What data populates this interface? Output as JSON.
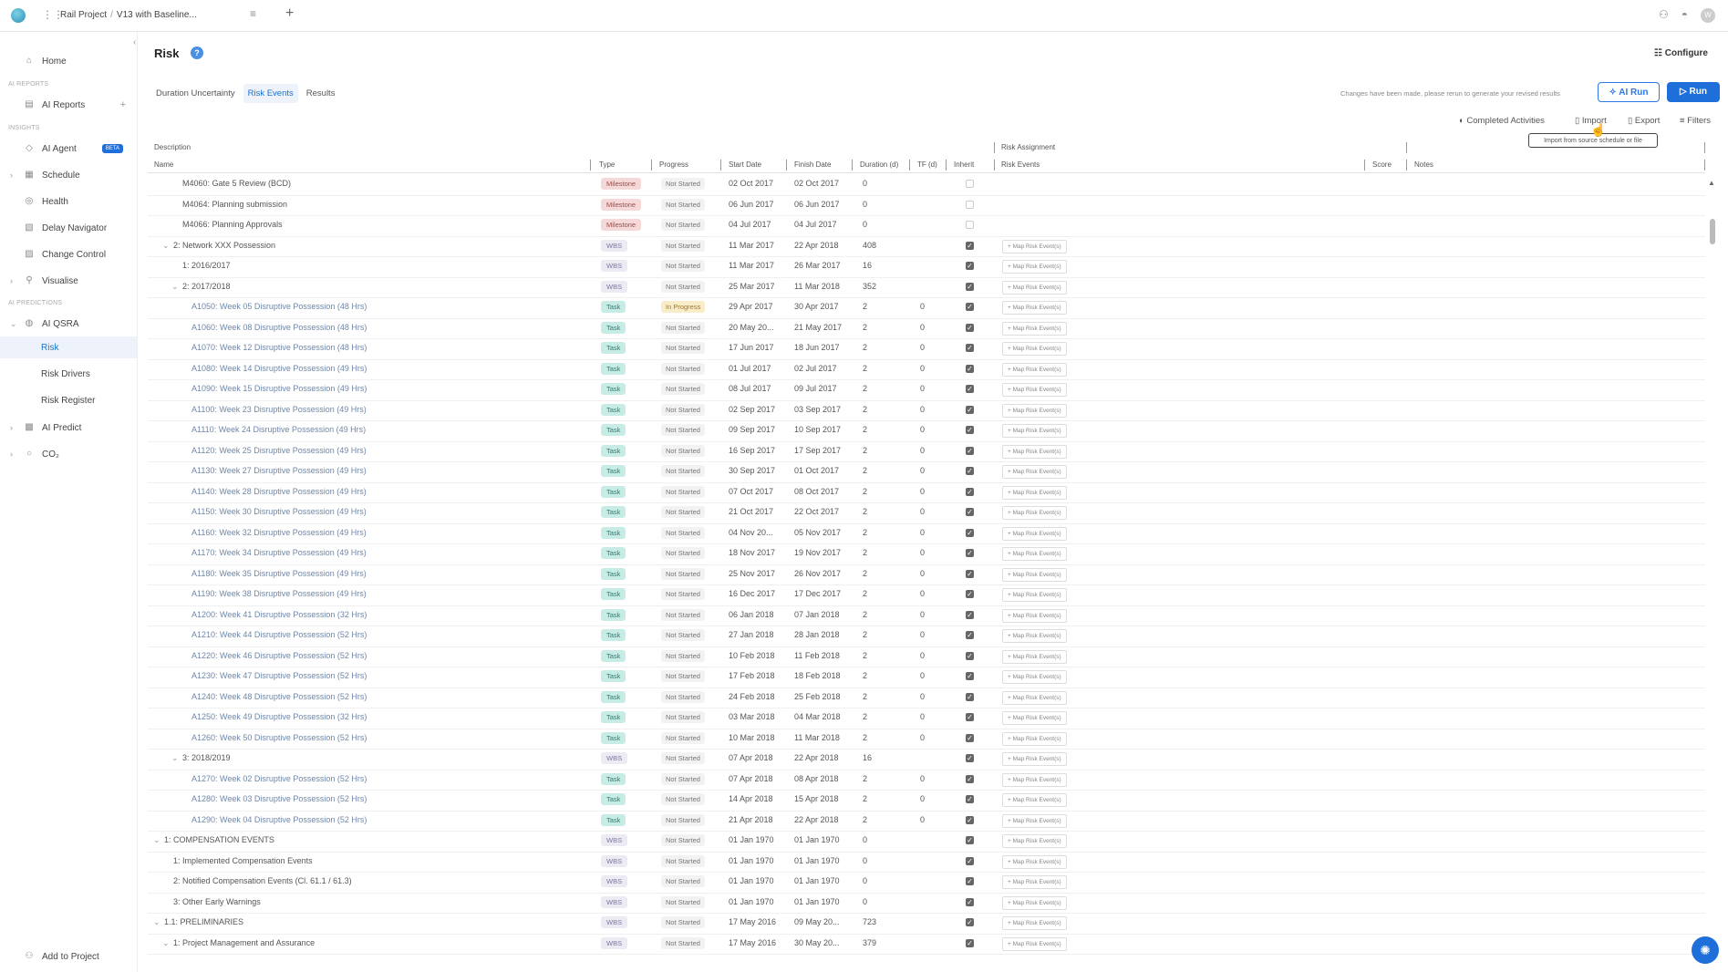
{
  "topbar": {
    "project": "Rail Project",
    "version": "V13 with Baseline...",
    "avatar": "W"
  },
  "sidebar": {
    "home": "Home",
    "section_ai_reports": "AI REPORTS",
    "ai_reports": "AI Reports",
    "section_insights": "INSIGHTS",
    "ai_agent": "AI Agent",
    "beta": "BETA",
    "schedule": "Schedule",
    "health": "Health",
    "delay_navigator": "Delay Navigator",
    "change_control": "Change Control",
    "visualise": "Visualise",
    "section_ai_predictions": "AI PREDICTIONS",
    "ai_qsra": "AI QSRA",
    "risk": "Risk",
    "risk_drivers": "Risk Drivers",
    "risk_register": "Risk Register",
    "ai_predict": "AI Predict",
    "co2": "CO₂",
    "add_to_project": "Add to Project"
  },
  "header": {
    "title": "Risk",
    "configure": "Configure",
    "tabs": [
      "Duration Uncertainty",
      "Risk Events",
      "Results"
    ],
    "active_tab": "Risk Events",
    "notice": "Changes have been made, please rerun to generate your revised results",
    "ai_run": "AI Run",
    "run": "Run"
  },
  "toolbar": {
    "completed": "Completed Activities",
    "import": "Import",
    "export": "Export",
    "filters": "Filters",
    "tooltip": "Import from source schedule or file"
  },
  "table": {
    "group_description": "Description",
    "group_risk": "Risk Assignment",
    "headers": [
      "Name",
      "Type",
      "Progress",
      "Start Date",
      "Finish Date",
      "Duration (d)",
      "TF (d)",
      "Inherit",
      "Risk Events",
      "Score",
      "Notes"
    ],
    "map_label": "+ Map Risk Event(s)",
    "rows": [
      {
        "indent": 3,
        "chev": "",
        "name": "M4060: Gate 5 Review (BCD)",
        "type": "Milestone",
        "progress": "Not Started",
        "start": "02 Oct 2017",
        "finish": "02 Oct 2017",
        "dur": "0",
        "tf": "",
        "inherit": false,
        "map": false
      },
      {
        "indent": 3,
        "chev": "",
        "name": "M4064: Planning submission",
        "type": "Milestone",
        "progress": "Not Started",
        "start": "06 Jun 2017",
        "finish": "06 Jun 2017",
        "dur": "0",
        "tf": "",
        "inherit": false,
        "map": false
      },
      {
        "indent": 3,
        "chev": "",
        "name": "M4066: Planning Approvals",
        "type": "Milestone",
        "progress": "Not Started",
        "start": "04 Jul 2017",
        "finish": "04 Jul 2017",
        "dur": "0",
        "tf": "",
        "inherit": false,
        "map": false
      },
      {
        "indent": 2,
        "chev": "v",
        "name": "2: Network XXX Possession",
        "type": "WBS",
        "progress": "Not Started",
        "start": "11 Mar 2017",
        "finish": "22 Apr 2018",
        "dur": "408",
        "tf": "",
        "inherit": true,
        "map": true
      },
      {
        "indent": 3,
        "chev": "",
        "name": "1: 2016/2017",
        "type": "WBS",
        "progress": "Not Started",
        "start": "11 Mar 2017",
        "finish": "26 Mar 2017",
        "dur": "16",
        "tf": "",
        "inherit": true,
        "map": true
      },
      {
        "indent": 3,
        "chev": "v",
        "name": "2: 2017/2018",
        "type": "WBS",
        "progress": "Not Started",
        "start": "25 Mar 2017",
        "finish": "11 Mar 2018",
        "dur": "352",
        "tf": "",
        "inherit": true,
        "map": true
      },
      {
        "indent": 4,
        "chev": "",
        "name": "A1050: Week 05 Disruptive Possession (48 Hrs)",
        "type": "Task",
        "progress": "In Progress",
        "start": "29 Apr 2017",
        "finish": "30 Apr 2017",
        "dur": "2",
        "tf": "0",
        "inherit": true,
        "map": true
      },
      {
        "indent": 4,
        "chev": "",
        "name": "A1060: Week 08 Disruptive Possession (48 Hrs)",
        "type": "Task",
        "progress": "Not Started",
        "start": "20 May 20...",
        "finish": "21 May 2017",
        "dur": "2",
        "tf": "0",
        "inherit": true,
        "map": true
      },
      {
        "indent": 4,
        "chev": "",
        "name": "A1070: Week 12 Disruptive Possession (48 Hrs)",
        "type": "Task",
        "progress": "Not Started",
        "start": "17 Jun 2017",
        "finish": "18 Jun 2017",
        "dur": "2",
        "tf": "0",
        "inherit": true,
        "map": true
      },
      {
        "indent": 4,
        "chev": "",
        "name": "A1080: Week 14 Disruptive Possession (49 Hrs)",
        "type": "Task",
        "progress": "Not Started",
        "start": "01 Jul 2017",
        "finish": "02 Jul 2017",
        "dur": "2",
        "tf": "0",
        "inherit": true,
        "map": true
      },
      {
        "indent": 4,
        "chev": "",
        "name": "A1090: Week 15 Disruptive Possession (49 Hrs)",
        "type": "Task",
        "progress": "Not Started",
        "start": "08 Jul 2017",
        "finish": "09 Jul 2017",
        "dur": "2",
        "tf": "0",
        "inherit": true,
        "map": true
      },
      {
        "indent": 4,
        "chev": "",
        "name": "A1100: Week 23 Disruptive Possession (49 Hrs)",
        "type": "Task",
        "progress": "Not Started",
        "start": "02 Sep 2017",
        "finish": "03 Sep 2017",
        "dur": "2",
        "tf": "0",
        "inherit": true,
        "map": true
      },
      {
        "indent": 4,
        "chev": "",
        "name": "A1110: Week 24 Disruptive Possession (49 Hrs)",
        "type": "Task",
        "progress": "Not Started",
        "start": "09 Sep 2017",
        "finish": "10 Sep 2017",
        "dur": "2",
        "tf": "0",
        "inherit": true,
        "map": true
      },
      {
        "indent": 4,
        "chev": "",
        "name": "A1120: Week 25 Disruptive Possession (49 Hrs)",
        "type": "Task",
        "progress": "Not Started",
        "start": "16 Sep 2017",
        "finish": "17 Sep 2017",
        "dur": "2",
        "tf": "0",
        "inherit": true,
        "map": true
      },
      {
        "indent": 4,
        "chev": "",
        "name": "A1130: Week 27 Disruptive Possession (49 Hrs)",
        "type": "Task",
        "progress": "Not Started",
        "start": "30 Sep 2017",
        "finish": "01 Oct 2017",
        "dur": "2",
        "tf": "0",
        "inherit": true,
        "map": true
      },
      {
        "indent": 4,
        "chev": "",
        "name": "A1140: Week 28 Disruptive Possession (49 Hrs)",
        "type": "Task",
        "progress": "Not Started",
        "start": "07 Oct 2017",
        "finish": "08 Oct 2017",
        "dur": "2",
        "tf": "0",
        "inherit": true,
        "map": true
      },
      {
        "indent": 4,
        "chev": "",
        "name": "A1150: Week 30 Disruptive Possession (49 Hrs)",
        "type": "Task",
        "progress": "Not Started",
        "start": "21 Oct 2017",
        "finish": "22 Oct 2017",
        "dur": "2",
        "tf": "0",
        "inherit": true,
        "map": true
      },
      {
        "indent": 4,
        "chev": "",
        "name": "A1160: Week 32 Disruptive Possession (49 Hrs)",
        "type": "Task",
        "progress": "Not Started",
        "start": "04 Nov 20...",
        "finish": "05 Nov 2017",
        "dur": "2",
        "tf": "0",
        "inherit": true,
        "map": true
      },
      {
        "indent": 4,
        "chev": "",
        "name": "A1170: Week 34 Disruptive Possession (49 Hrs)",
        "type": "Task",
        "progress": "Not Started",
        "start": "18 Nov 2017",
        "finish": "19 Nov 2017",
        "dur": "2",
        "tf": "0",
        "inherit": true,
        "map": true
      },
      {
        "indent": 4,
        "chev": "",
        "name": "A1180: Week 35 Disruptive Possession (49 Hrs)",
        "type": "Task",
        "progress": "Not Started",
        "start": "25 Nov 2017",
        "finish": "26 Nov 2017",
        "dur": "2",
        "tf": "0",
        "inherit": true,
        "map": true
      },
      {
        "indent": 4,
        "chev": "",
        "name": "A1190: Week 38 Disruptive Possession (49 Hrs)",
        "type": "Task",
        "progress": "Not Started",
        "start": "16 Dec 2017",
        "finish": "17 Dec 2017",
        "dur": "2",
        "tf": "0",
        "inherit": true,
        "map": true
      },
      {
        "indent": 4,
        "chev": "",
        "name": "A1200: Week 41 Disruptive Possession (32 Hrs)",
        "type": "Task",
        "progress": "Not Started",
        "start": "06 Jan 2018",
        "finish": "07 Jan 2018",
        "dur": "2",
        "tf": "0",
        "inherit": true,
        "map": true
      },
      {
        "indent": 4,
        "chev": "",
        "name": "A1210: Week 44 Disruptive Possession (52 Hrs)",
        "type": "Task",
        "progress": "Not Started",
        "start": "27 Jan 2018",
        "finish": "28 Jan 2018",
        "dur": "2",
        "tf": "0",
        "inherit": true,
        "map": true
      },
      {
        "indent": 4,
        "chev": "",
        "name": "A1220: Week 46 Disruptive Possession (52 Hrs)",
        "type": "Task",
        "progress": "Not Started",
        "start": "10 Feb 2018",
        "finish": "11 Feb 2018",
        "dur": "2",
        "tf": "0",
        "inherit": true,
        "map": true
      },
      {
        "indent": 4,
        "chev": "",
        "name": "A1230: Week 47 Disruptive Possession (52 Hrs)",
        "type": "Task",
        "progress": "Not Started",
        "start": "17 Feb 2018",
        "finish": "18 Feb 2018",
        "dur": "2",
        "tf": "0",
        "inherit": true,
        "map": true
      },
      {
        "indent": 4,
        "chev": "",
        "name": "A1240: Week 48 Disruptive Possession (52 Hrs)",
        "type": "Task",
        "progress": "Not Started",
        "start": "24 Feb 2018",
        "finish": "25 Feb 2018",
        "dur": "2",
        "tf": "0",
        "inherit": true,
        "map": true
      },
      {
        "indent": 4,
        "chev": "",
        "name": "A1250: Week 49 Disruptive Possession (32 Hrs)",
        "type": "Task",
        "progress": "Not Started",
        "start": "03 Mar 2018",
        "finish": "04 Mar 2018",
        "dur": "2",
        "tf": "0",
        "inherit": true,
        "map": true
      },
      {
        "indent": 4,
        "chev": "",
        "name": "A1260: Week 50 Disruptive Possession (52 Hrs)",
        "type": "Task",
        "progress": "Not Started",
        "start": "10 Mar 2018",
        "finish": "11 Mar 2018",
        "dur": "2",
        "tf": "0",
        "inherit": true,
        "map": true
      },
      {
        "indent": 3,
        "chev": "v",
        "name": "3: 2018/2019",
        "type": "WBS",
        "progress": "Not Started",
        "start": "07 Apr 2018",
        "finish": "22 Apr 2018",
        "dur": "16",
        "tf": "",
        "inherit": true,
        "map": true
      },
      {
        "indent": 4,
        "chev": "",
        "name": "A1270: Week 02 Disruptive Possession (52 Hrs)",
        "type": "Task",
        "progress": "Not Started",
        "start": "07 Apr 2018",
        "finish": "08 Apr 2018",
        "dur": "2",
        "tf": "0",
        "inherit": true,
        "map": true
      },
      {
        "indent": 4,
        "chev": "",
        "name": "A1280: Week 03 Disruptive Possession (52 Hrs)",
        "type": "Task",
        "progress": "Not Started",
        "start": "14 Apr 2018",
        "finish": "15 Apr 2018",
        "dur": "2",
        "tf": "0",
        "inherit": true,
        "map": true
      },
      {
        "indent": 4,
        "chev": "",
        "name": "A1290: Week 04 Disruptive Possession (52 Hrs)",
        "type": "Task",
        "progress": "Not Started",
        "start": "21 Apr 2018",
        "finish": "22 Apr 2018",
        "dur": "2",
        "tf": "0",
        "inherit": true,
        "map": true
      },
      {
        "indent": 1,
        "chev": "v",
        "name": "1: COMPENSATION EVENTS",
        "type": "WBS",
        "progress": "Not Started",
        "start": "01 Jan 1970",
        "finish": "01 Jan 1970",
        "dur": "0",
        "tf": "",
        "inherit": true,
        "map": true
      },
      {
        "indent": 2,
        "chev": "",
        "name": "1: Implemented Compensation Events",
        "type": "WBS",
        "progress": "Not Started",
        "start": "01 Jan 1970",
        "finish": "01 Jan 1970",
        "dur": "0",
        "tf": "",
        "inherit": true,
        "map": true
      },
      {
        "indent": 2,
        "chev": "",
        "name": "2: Notified Compensation Events (Cl. 61.1 / 61.3)",
        "type": "WBS",
        "progress": "Not Started",
        "start": "01 Jan 1970",
        "finish": "01 Jan 1970",
        "dur": "0",
        "tf": "",
        "inherit": true,
        "map": true
      },
      {
        "indent": 2,
        "chev": "",
        "name": "3: Other Early Warnings",
        "type": "WBS",
        "progress": "Not Started",
        "start": "01 Jan 1970",
        "finish": "01 Jan 1970",
        "dur": "0",
        "tf": "",
        "inherit": true,
        "map": true
      },
      {
        "indent": 1,
        "chev": "v",
        "name": "1.1: PRELIMINARIES",
        "type": "WBS",
        "progress": "Not Started",
        "start": "17 May 2016",
        "finish": "09 May 20...",
        "dur": "723",
        "tf": "",
        "inherit": true,
        "map": true
      },
      {
        "indent": 2,
        "chev": "v",
        "name": "1: Project Management and Assurance",
        "type": "WBS",
        "progress": "Not Started",
        "start": "17 May 2016",
        "finish": "30 May 20...",
        "dur": "379",
        "tf": "",
        "inherit": true,
        "map": true
      }
    ]
  },
  "colors": {
    "accent": "#1e6fd9",
    "task_badge": "#c7ece6",
    "milestone_badge": "#f5d8d8",
    "wbs_badge": "#ecebf4"
  }
}
